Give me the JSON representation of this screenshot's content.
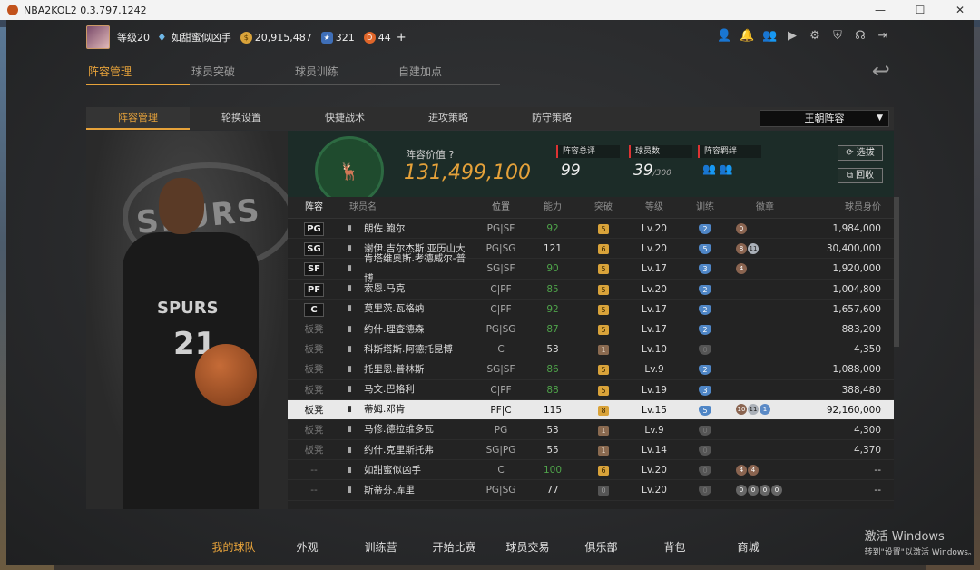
{
  "window": {
    "title": "NBA2KOL2 0.3.797.1242",
    "minimize": "—",
    "maximize": "☐",
    "close": "✕"
  },
  "profile": {
    "level": "等级20",
    "username": "如甜蜜似凶手",
    "gold": "20,915,487",
    "stars": "321",
    "d_points": "44",
    "plus": "+"
  },
  "top_icons": [
    "user-icon",
    "bell-icon",
    "friends-icon",
    "video-icon",
    "gear-icon",
    "shield-icon",
    "headset-icon",
    "exit-icon"
  ],
  "main_tabs": [
    "阵容管理",
    "球员突破",
    "球员训练",
    "自建加点"
  ],
  "sub_tabs": [
    "阵容管理",
    "轮换设置",
    "快捷战术",
    "进攻策略",
    "防守策略"
  ],
  "lineup_select": "王朝阵容",
  "art": {
    "team_text": "SPURS",
    "jersey_name": "SPURS",
    "jersey_number": "21"
  },
  "team": {
    "value_label": "阵容价值",
    "value": "131,499,100",
    "rating_label": "阵容总评",
    "rating": "99",
    "count_label": "球员数",
    "count": "39",
    "count_max": "/300",
    "chem_label": "阵容羁绊",
    "btn_select": "选拔",
    "btn_recycle": "回收"
  },
  "table_headers": {
    "pos": "阵容",
    "name": "球员名",
    "role": "位置",
    "ovr": "能力",
    "brk": "突破",
    "lv": "等级",
    "tr": "训练",
    "badge": "徽章",
    "val": "球员身价"
  },
  "players": [
    {
      "slot": "PG",
      "name": "朗佐.鲍尔",
      "role": "PG|SF",
      "ovr": "92",
      "brk": "5",
      "lv": "Lv.20",
      "tr": "2",
      "badges": [
        "0"
      ],
      "val": "1,984,000"
    },
    {
      "slot": "SG",
      "name": "谢伊.吉尔杰斯.亚历山大",
      "role": "PG|SG",
      "ovr": "121",
      "brk": "6",
      "lv": "Lv.20",
      "tr": "5",
      "badges": [
        "8",
        "11"
      ],
      "val": "30,400,000"
    },
    {
      "slot": "SF",
      "name": "肯塔维奥斯.考德威尔-普博",
      "role": "SG|SF",
      "ovr": "90",
      "brk": "5",
      "lv": "Lv.17",
      "tr": "3",
      "badges": [
        "4"
      ],
      "val": "1,920,000"
    },
    {
      "slot": "PF",
      "name": "索恩.马克",
      "role": "C|PF",
      "ovr": "85",
      "brk": "5",
      "lv": "Lv.20",
      "tr": "2",
      "badges": [],
      "val": "1,004,800"
    },
    {
      "slot": "C",
      "name": "莫里茨.瓦格纳",
      "role": "C|PF",
      "ovr": "92",
      "brk": "5",
      "lv": "Lv.17",
      "tr": "2",
      "badges": [],
      "val": "1,657,600"
    },
    {
      "slot": "板凳",
      "name": "约什.理查德森",
      "role": "PG|SG",
      "ovr": "87",
      "brk": "5",
      "lv": "Lv.17",
      "tr": "2",
      "badges": [],
      "val": "883,200"
    },
    {
      "slot": "板凳",
      "name": "科斯塔斯.阿德托昆博",
      "role": "C",
      "ovr": "53",
      "brk": "1",
      "lv": "Lv.10",
      "tr": "0",
      "badges": [],
      "val": "4,350"
    },
    {
      "slot": "板凳",
      "name": "托里恩.普林斯",
      "role": "SG|SF",
      "ovr": "86",
      "brk": "5",
      "lv": "Lv.9",
      "tr": "2",
      "badges": [],
      "val": "1,088,000"
    },
    {
      "slot": "板凳",
      "name": "马文.巴格利",
      "role": "C|PF",
      "ovr": "88",
      "brk": "5",
      "lv": "Lv.19",
      "tr": "3",
      "badges": [],
      "val": "388,480"
    },
    {
      "slot": "板凳",
      "name": "蒂姆.邓肯",
      "role": "PF|C",
      "ovr": "115",
      "brk": "8",
      "lv": "Lv.15",
      "tr": "5",
      "badges": [
        "10",
        "11",
        "1"
      ],
      "val": "92,160,000",
      "selected": true
    },
    {
      "slot": "板凳",
      "name": "马修.德拉维多瓦",
      "role": "PG",
      "ovr": "53",
      "brk": "1",
      "lv": "Lv.9",
      "tr": "0",
      "badges": [],
      "val": "4,300"
    },
    {
      "slot": "板凳",
      "name": "约什.克里斯托弗",
      "role": "SG|PG",
      "ovr": "55",
      "brk": "1",
      "lv": "Lv.14",
      "tr": "0",
      "badges": [],
      "val": "4,370"
    },
    {
      "slot": "--",
      "name": "如甜蜜似凶手",
      "role": "C",
      "ovr": "100",
      "brk": "6",
      "lv": "Lv.20",
      "tr": "0",
      "badges": [
        "4",
        "4"
      ],
      "val": "--"
    },
    {
      "slot": "--",
      "name": "斯蒂芬.库里",
      "role": "PG|SG",
      "ovr": "77",
      "brk": "0",
      "lv": "Lv.20",
      "tr": "0",
      "badges": [
        "0",
        "0",
        "0",
        "0"
      ],
      "val": "--"
    }
  ],
  "bottom_nav": [
    "我的球队",
    "外观",
    "训练营",
    "开始比赛",
    "球员交易",
    "俱乐部",
    "背包",
    "商城"
  ],
  "watermark": {
    "line1": "激活 Windows",
    "line2": "转到\"设置\"以激活 Windows。"
  }
}
